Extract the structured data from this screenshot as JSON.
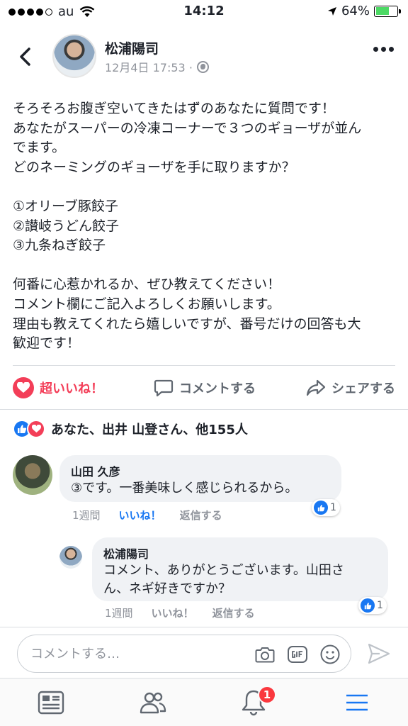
{
  "status_bar": {
    "carrier": "au",
    "time": "14:12",
    "battery": "64%",
    "battery_level": 0.64,
    "signal_dots": 5,
    "signal_filled": 4
  },
  "post": {
    "author": "松浦陽司",
    "timestamp": "12月4日 17:53 ·",
    "body_lines": [
      "そろそろお腹ぎ空いてきたはずのあなたに質問です！",
      "あなたがスーパーの冷凍コーナーで３つのギョーザが並ん",
      "でます。",
      "どのネーミングのギョーザを手に取りますか？",
      "",
      "①オリーブ豚餃子",
      "②讃岐うどん餃子",
      "③九条ねぎ餃子",
      "",
      "何番に心惹かれるか、ぜひ教えてください！",
      "コメント欄にご記入よろしくお願いします。",
      "理由も教えてくれたら嬉しいですが、番号だけの回答も大",
      "歓迎です！"
    ]
  },
  "actions": {
    "love": "超いいね！",
    "comment": "コメントする",
    "share": "シェアする"
  },
  "reactions": {
    "summary": "あなた、出井 山登さん、他155人"
  },
  "comments": [
    {
      "name": "山田 久彦",
      "text": "③です。一番美味しく感じられるから。",
      "time": "1週間",
      "like": "いいね！",
      "reply": "返信する",
      "like_count": "1"
    },
    {
      "name": "松浦陽司",
      "text_lines": [
        "コメント、ありがとうございます。山田さ",
        "ん、ネギ好きですか？"
      ],
      "time": "1週間",
      "like": "いいね！",
      "reply": "返信する",
      "like_count": "1"
    }
  ],
  "comment_input": {
    "placeholder": "コメントする…"
  },
  "tabbar": {
    "notification_count": "1"
  },
  "colors": {
    "accent": "#1877f2",
    "love": "#f33e58",
    "muted": "#90949c",
    "badge": "#fa383e"
  }
}
